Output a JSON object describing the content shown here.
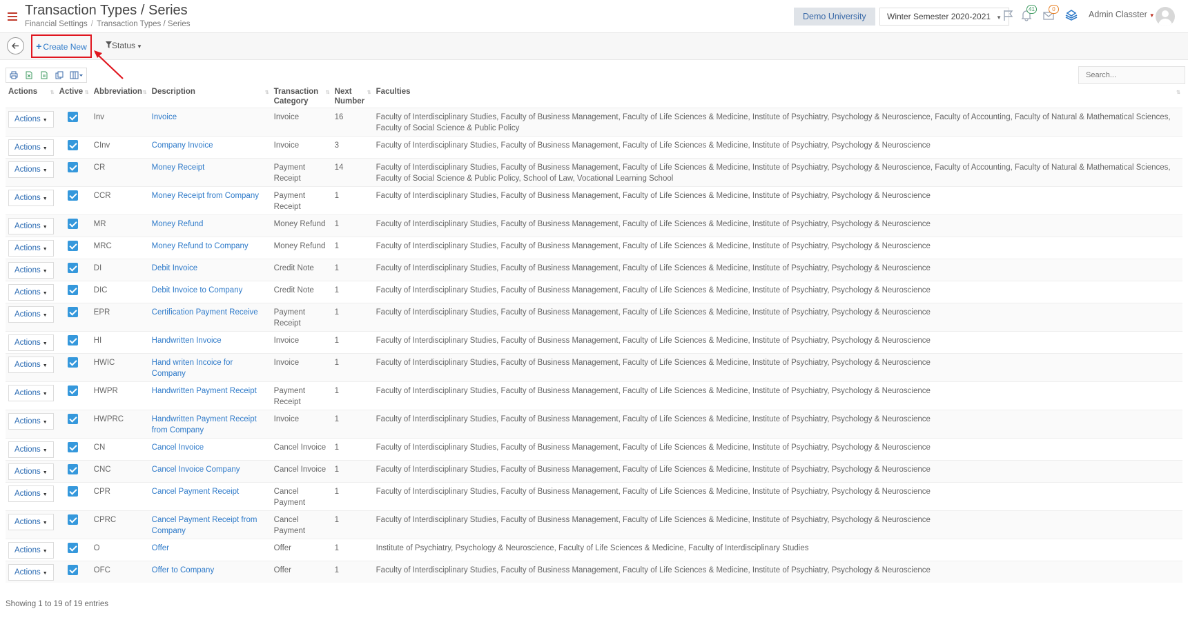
{
  "header": {
    "title": "Transaction Types / Series",
    "breadcrumb": [
      "Financial Settings",
      "Transaction Types / Series"
    ],
    "university": "Demo University",
    "semester": "Winter Semester 2020-2021",
    "notifications_count": "41",
    "messages_count": "0",
    "user": "Admin Classter"
  },
  "toolbar": {
    "create_new": "Create New",
    "status": "Status"
  },
  "table": {
    "search_placeholder": "Search...",
    "columns": [
      "Actions",
      "Active",
      "Abbreviation",
      "Description",
      "Transaction Category",
      "Next Number",
      "Faculties"
    ],
    "actions_label": "Actions",
    "rows": [
      {
        "abbr": "Inv",
        "desc": "Invoice",
        "cat": "Invoice",
        "next": "16",
        "fac": "Faculty of Interdisciplinary Studies, Faculty of Business Management, Faculty of Life Sciences & Medicine, Institute of Psychiatry, Psychology & Neuroscience, Faculty of Accounting, Faculty of Natural & Mathematical Sciences, Faculty of Social Science & Public Policy"
      },
      {
        "abbr": "CInv",
        "desc": "Company Invoice",
        "cat": "Invoice",
        "next": "3",
        "fac": "Faculty of Interdisciplinary Studies, Faculty of Business Management, Faculty of Life Sciences & Medicine, Institute of Psychiatry, Psychology & Neuroscience"
      },
      {
        "abbr": "CR",
        "desc": "Money Receipt",
        "cat": "Payment Receipt",
        "next": "14",
        "fac": "Faculty of Interdisciplinary Studies, Faculty of Business Management, Faculty of Life Sciences & Medicine, Institute of Psychiatry, Psychology & Neuroscience, Faculty of Accounting, Faculty of Natural & Mathematical Sciences, Faculty of Social Science & Public Policy, School of Law, Vocational Learning School"
      },
      {
        "abbr": "CCR",
        "desc": "Money Receipt from Company",
        "cat": "Payment Receipt",
        "next": "1",
        "fac": "Faculty of Interdisciplinary Studies, Faculty of Business Management, Faculty of Life Sciences & Medicine, Institute of Psychiatry, Psychology & Neuroscience"
      },
      {
        "abbr": "MR",
        "desc": "Money Refund",
        "cat": "Money Refund",
        "next": "1",
        "fac": "Faculty of Interdisciplinary Studies, Faculty of Business Management, Faculty of Life Sciences & Medicine, Institute of Psychiatry, Psychology & Neuroscience"
      },
      {
        "abbr": "MRC",
        "desc": "Money Refund to Company",
        "cat": "Money Refund",
        "next": "1",
        "fac": "Faculty of Interdisciplinary Studies, Faculty of Business Management, Faculty of Life Sciences & Medicine, Institute of Psychiatry, Psychology & Neuroscience"
      },
      {
        "abbr": "DI",
        "desc": "Debit Invoice",
        "cat": "Credit Note",
        "next": "1",
        "fac": "Faculty of Interdisciplinary Studies, Faculty of Business Management, Faculty of Life Sciences & Medicine, Institute of Psychiatry, Psychology & Neuroscience"
      },
      {
        "abbr": "DIC",
        "desc": "Debit Invoice to Company",
        "cat": "Credit Note",
        "next": "1",
        "fac": "Faculty of Interdisciplinary Studies, Faculty of Business Management, Faculty of Life Sciences & Medicine, Institute of Psychiatry, Psychology & Neuroscience"
      },
      {
        "abbr": "EPR",
        "desc": "Certification Payment Receive",
        "cat": "Payment Receipt",
        "next": "1",
        "fac": "Faculty of Interdisciplinary Studies, Faculty of Business Management, Faculty of Life Sciences & Medicine, Institute of Psychiatry, Psychology & Neuroscience"
      },
      {
        "abbr": "HI",
        "desc": "Handwritten Invoice",
        "cat": "Invoice",
        "next": "1",
        "fac": "Faculty of Interdisciplinary Studies, Faculty of Business Management, Faculty of Life Sciences & Medicine, Institute of Psychiatry, Psychology & Neuroscience"
      },
      {
        "abbr": "HWIC",
        "desc": "Hand writen Incoice for Company",
        "cat": "Invoice",
        "next": "1",
        "fac": "Faculty of Interdisciplinary Studies, Faculty of Business Management, Faculty of Life Sciences & Medicine, Institute of Psychiatry, Psychology & Neuroscience"
      },
      {
        "abbr": "HWPR",
        "desc": "Handwritten Payment Receipt",
        "cat": "Payment Receipt",
        "next": "1",
        "fac": "Faculty of Interdisciplinary Studies, Faculty of Business Management, Faculty of Life Sciences & Medicine, Institute of Psychiatry, Psychology & Neuroscience"
      },
      {
        "abbr": "HWPRC",
        "desc": "Handwritten Payment Receipt from Company",
        "cat": "Invoice",
        "next": "1",
        "fac": "Faculty of Interdisciplinary Studies, Faculty of Business Management, Faculty of Life Sciences & Medicine, Institute of Psychiatry, Psychology & Neuroscience"
      },
      {
        "abbr": "CN",
        "desc": "Cancel Invoice",
        "cat": "Cancel Invoice",
        "next": "1",
        "fac": "Faculty of Interdisciplinary Studies, Faculty of Business Management, Faculty of Life Sciences & Medicine, Institute of Psychiatry, Psychology & Neuroscience"
      },
      {
        "abbr": "CNC",
        "desc": "Cancel Invoice Company",
        "cat": "Cancel Invoice",
        "next": "1",
        "fac": "Faculty of Interdisciplinary Studies, Faculty of Business Management, Faculty of Life Sciences & Medicine, Institute of Psychiatry, Psychology & Neuroscience"
      },
      {
        "abbr": "CPR",
        "desc": "Cancel Payment Receipt",
        "cat": "Cancel Payment",
        "next": "1",
        "fac": "Faculty of Interdisciplinary Studies, Faculty of Business Management, Faculty of Life Sciences & Medicine, Institute of Psychiatry, Psychology & Neuroscience"
      },
      {
        "abbr": "CPRC",
        "desc": "Cancel Payment Receipt from Company",
        "cat": "Cancel Payment",
        "next": "1",
        "fac": "Faculty of Interdisciplinary Studies, Faculty of Business Management, Faculty of Life Sciences & Medicine, Institute of Psychiatry, Psychology & Neuroscience"
      },
      {
        "abbr": "O",
        "desc": "Offer",
        "cat": "Offer",
        "next": "1",
        "fac": "Institute of Psychiatry, Psychology & Neuroscience, Faculty of Life Sciences & Medicine, Faculty of Interdisciplinary Studies"
      },
      {
        "abbr": "OFC",
        "desc": "Offer to Company",
        "cat": "Offer",
        "next": "1",
        "fac": "Faculty of Interdisciplinary Studies, Faculty of Business Management, Faculty of Life Sciences & Medicine, Institute of Psychiatry, Psychology & Neuroscience"
      }
    ],
    "info": "Showing 1 to 19 of 19 entries"
  },
  "colors": {
    "accent": "#2e7ac9",
    "highlight": "#e0161f",
    "checkbox": "#3598dc"
  }
}
